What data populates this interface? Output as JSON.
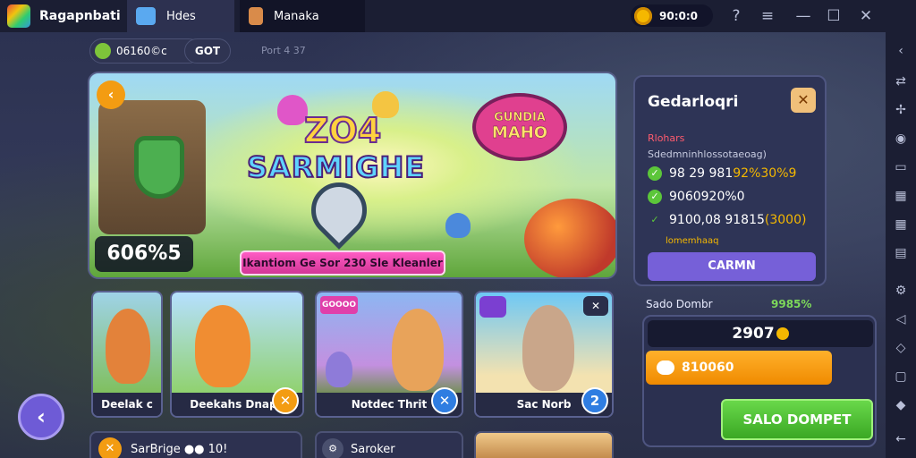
{
  "window": {
    "app_title": "Ragapnbati",
    "tabs": [
      {
        "label": "Hdes"
      },
      {
        "label": "Manaka"
      }
    ],
    "coins": "90:0:0",
    "controls": {
      "help": "?",
      "menu": "≡",
      "minimize": "—",
      "maximize": "☐",
      "close": "✕"
    }
  },
  "toolbar": {
    "balance_chip": "06160©c",
    "get_chip": "GOT",
    "breadcrumb": "Port 4 37"
  },
  "hero": {
    "year": "ZO4",
    "logo": "SARMIGHE",
    "badge_line1": "GUNDIA",
    "badge_line2": "MAHO",
    "score": "606%5",
    "ribbon": "Ikantiom Ge Sor 230 Sle Kleanler"
  },
  "cards": [
    {
      "label": "Deelak c"
    },
    {
      "label": "Deekahs Dnape",
      "corner": "✕"
    },
    {
      "label": "Notdec Thrit",
      "tag": "GOOOO",
      "corner": "✕"
    },
    {
      "label": "Sac Norb",
      "corner": "2",
      "top_right": "✕"
    }
  ],
  "bottom_cards": [
    {
      "label": "SarBrige ●● 10!",
      "icon": "✕"
    },
    {
      "label": "Saroker",
      "icon": "⚙"
    }
  ],
  "panel": {
    "title": "Gedarloqri",
    "subtitle": "Rlohars",
    "description": "Sdedmninhlossotaeoag)",
    "checks": [
      {
        "text": "98 29 981 ",
        "gold": "92%30%9"
      },
      {
        "text": "9060920%0",
        "gold": ""
      },
      {
        "text": "9100,08 91815 ",
        "gold": "(3000)"
      }
    ],
    "note": "lomemhaaq",
    "button": "CARMN"
  },
  "balance": {
    "label": "Sado Dombr",
    "value": "9985%",
    "amount": "2907",
    "orange_button": "810060",
    "green_button": "SALO DOMPET"
  },
  "colors": {
    "titlebar": "#1b1e33",
    "panel": "#2e3456",
    "accent_orange": "#f39c12",
    "accent_green": "#5cc63a",
    "accent_purple": "#7660d8"
  }
}
